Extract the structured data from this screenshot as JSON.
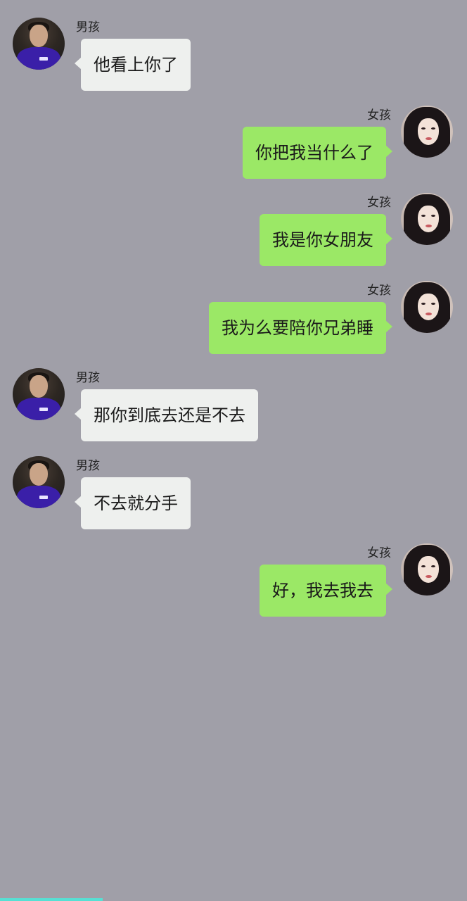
{
  "chat": {
    "messages": [
      {
        "side": "left",
        "sender": "男孩",
        "text": "他看上你了"
      },
      {
        "side": "right",
        "sender": "女孩",
        "text": "你把我当什么了"
      },
      {
        "side": "right",
        "sender": "女孩",
        "text": "我是你女朋友"
      },
      {
        "side": "right",
        "sender": "女孩",
        "text": "我为么要陪你兄弟睡"
      },
      {
        "side": "left",
        "sender": "男孩",
        "text": "那你到底去还是不去"
      },
      {
        "side": "left",
        "sender": "男孩",
        "text": "不去就分手"
      },
      {
        "side": "right",
        "sender": "女孩",
        "text": "好，我去我去"
      }
    ]
  },
  "colors": {
    "background": "#a09fa8",
    "incoming_bubble": "#eef0ee",
    "outgoing_bubble": "#9be866",
    "progress": "#56e0d4"
  },
  "video_progress": {
    "fraction": 0.22
  }
}
